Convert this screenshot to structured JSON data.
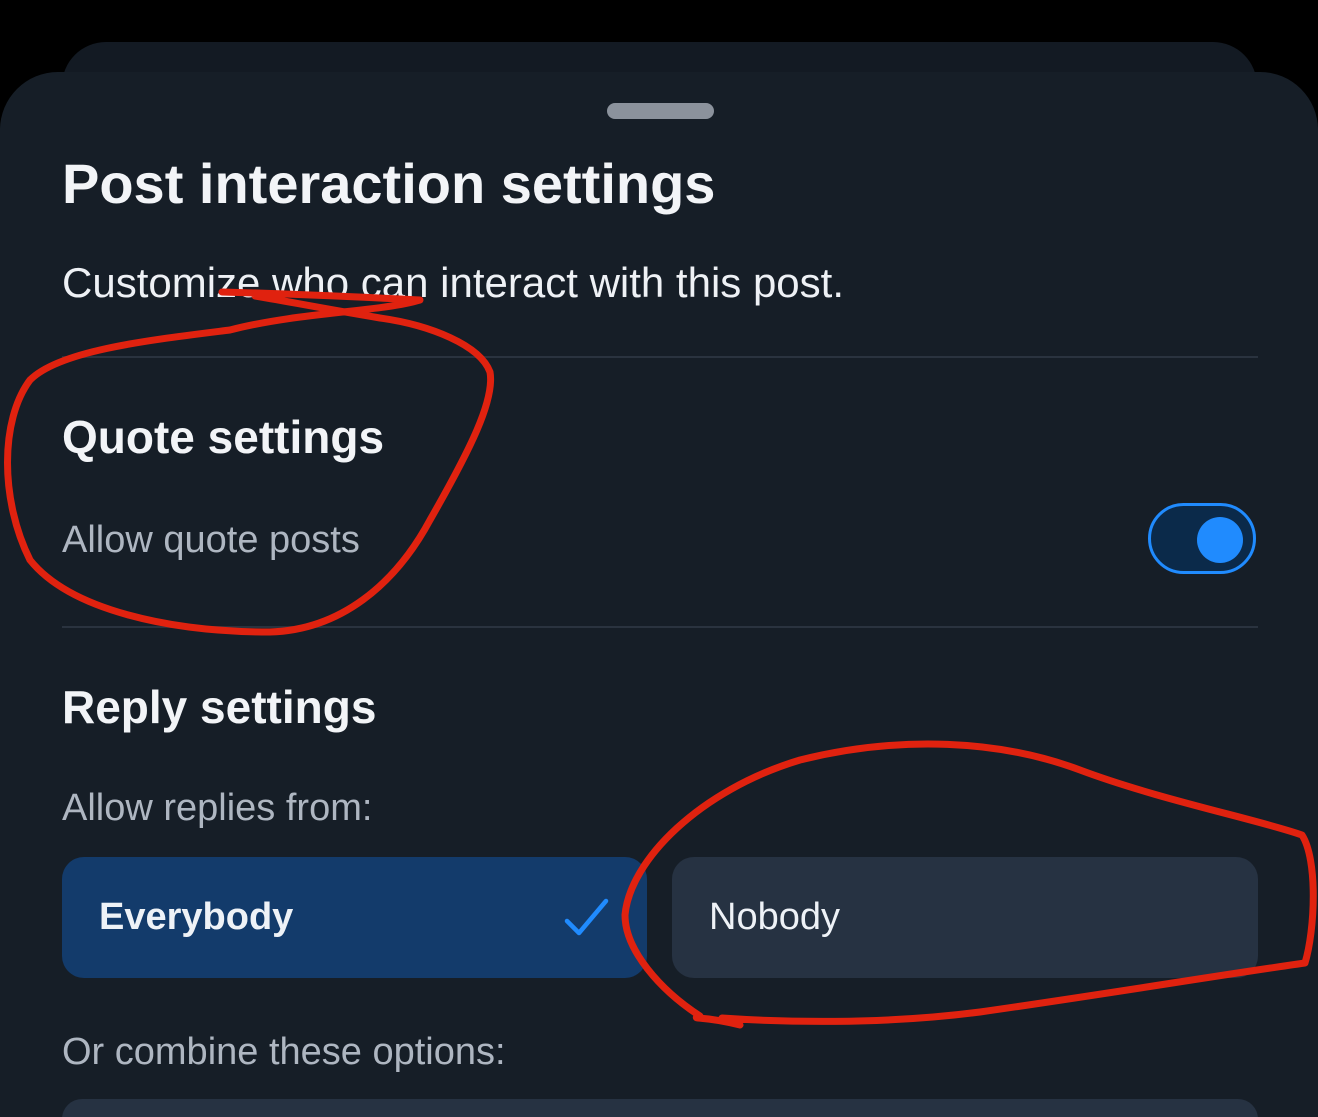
{
  "sheet": {
    "title": "Post interaction settings",
    "subtitle": "Customize who can interact with this post."
  },
  "quote_settings": {
    "heading": "Quote settings",
    "label": "Allow quote posts",
    "enabled": true
  },
  "reply_settings": {
    "heading": "Reply settings",
    "allow_label": "Allow replies from:",
    "options": [
      {
        "label": "Everybody",
        "selected": true
      },
      {
        "label": "Nobody",
        "selected": false
      }
    ],
    "combine_label": "Or combine these options:"
  },
  "icons": {
    "check": "check-icon",
    "toggle": "toggle-switch"
  },
  "colors": {
    "accent": "#208bfe",
    "background": "#161e27",
    "selected_option": "#133b6b",
    "unselected_option": "#263242",
    "annotation": "#e0220f"
  }
}
